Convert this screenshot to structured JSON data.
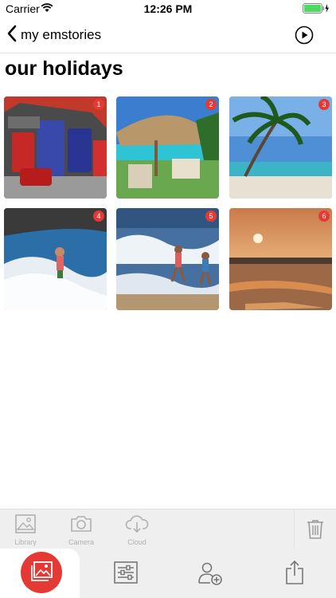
{
  "status_bar": {
    "carrier": "Carrier",
    "time": "12:26 PM"
  },
  "nav": {
    "back_label": "my emstories"
  },
  "page": {
    "title": "our holidays"
  },
  "photos": [
    {
      "badge": "1",
      "subject": "car trunk with luggage"
    },
    {
      "badge": "2",
      "subject": "straw umbrella by pool"
    },
    {
      "badge": "3",
      "subject": "palm tree beach"
    },
    {
      "badge": "4",
      "subject": "child in waves"
    },
    {
      "badge": "5",
      "subject": "kids running in surf"
    },
    {
      "badge": "6",
      "subject": "sunset over sea"
    }
  ],
  "toolbar": {
    "library": "Library",
    "camera": "Camera",
    "cloud": "Cloud"
  },
  "colors": {
    "accent": "#e53935",
    "toolbar_bg": "#efefef",
    "icon_gray": "#b0b0b0"
  }
}
